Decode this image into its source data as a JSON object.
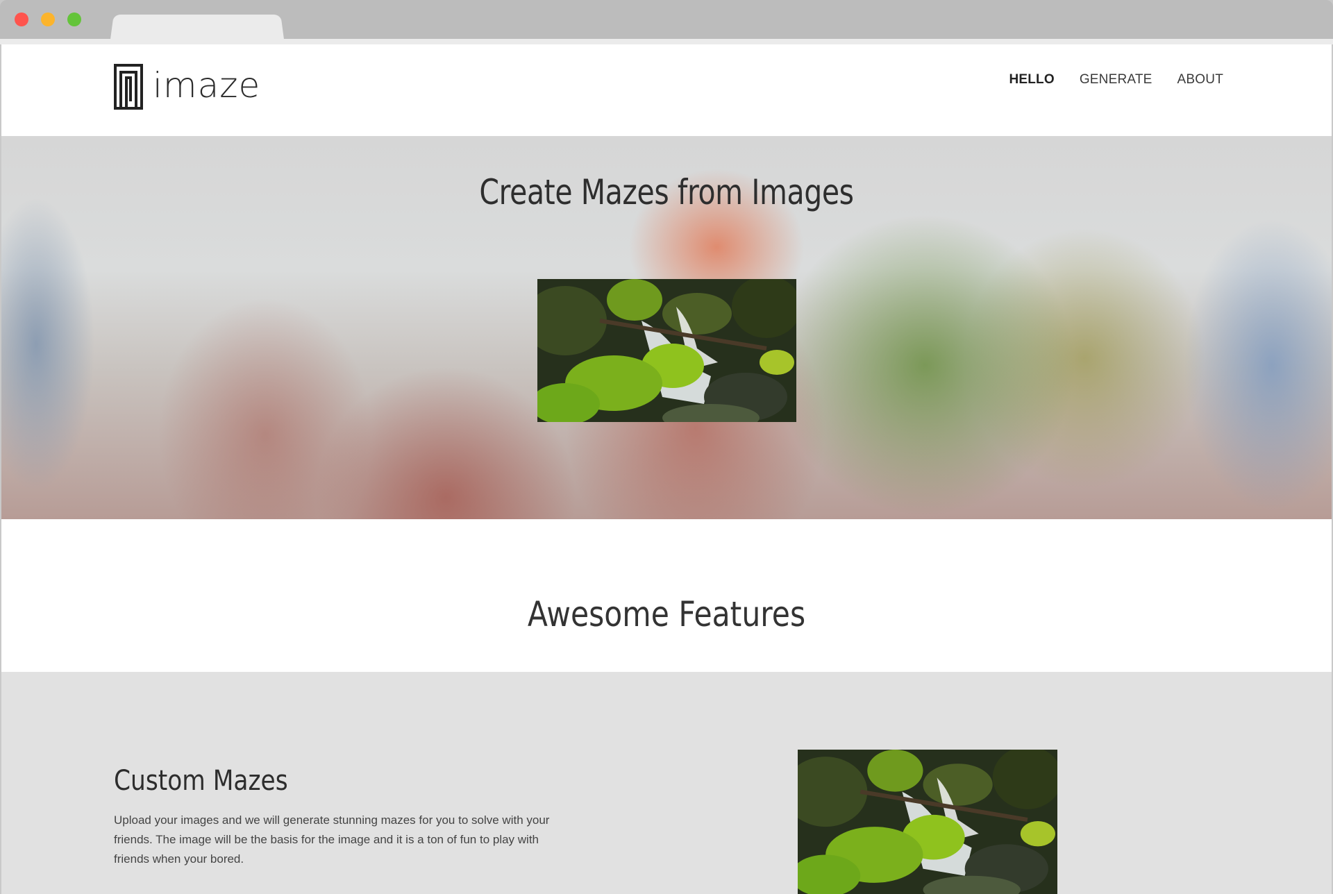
{
  "brand": {
    "name": "imaze"
  },
  "nav": {
    "items": [
      {
        "label": "HELLO",
        "active": true
      },
      {
        "label": "GENERATE",
        "active": false
      },
      {
        "label": "ABOUT",
        "active": false
      }
    ]
  },
  "hero": {
    "title": "Create Mazes from Images",
    "image": "waterfall-photo"
  },
  "features_heading": {
    "title": "Awesome Features"
  },
  "feature": {
    "title": "Custom Mazes",
    "description": "Upload your images and we will generate stunning mazes for you to solve with your friends. The image will be the basis for the image and it is a ton of fun to play with friends when your bored.",
    "image": "waterfall-photo"
  },
  "colors": {
    "features_bg": "#e1e1e1",
    "text": "#2e2e2e"
  }
}
